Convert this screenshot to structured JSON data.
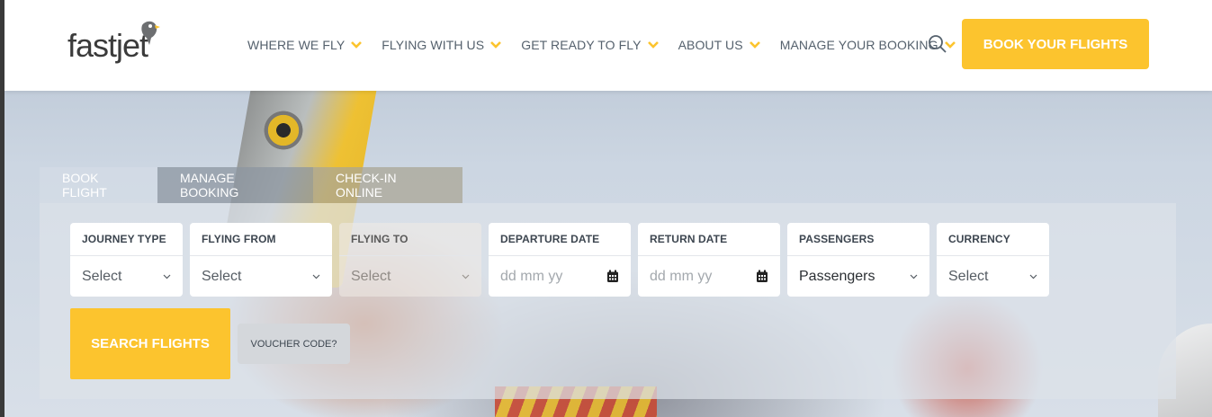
{
  "brand": {
    "logo_text": "fastjet",
    "accent": "#fcc42e",
    "text_color": "#55616d"
  },
  "nav": {
    "items": [
      {
        "label": "WHERE WE FLY"
      },
      {
        "label": "FLYING WITH US"
      },
      {
        "label": "GET READY TO FLY"
      },
      {
        "label": "ABOUT US"
      },
      {
        "label": "MANAGE YOUR BOOKING"
      }
    ],
    "search_icon": "search-icon",
    "cta_label": "BOOK YOUR FLIGHTS"
  },
  "widget": {
    "tabs": [
      {
        "label": "BOOK FLIGHT"
      },
      {
        "label": "MANAGE BOOKING"
      },
      {
        "label": "CHECK-IN ONLINE"
      }
    ],
    "fields": {
      "journey_type": {
        "label": "JOURNEY TYPE",
        "value": "Select"
      },
      "flying_from": {
        "label": "FLYING FROM",
        "value": "Select"
      },
      "flying_to": {
        "label": "FLYING TO",
        "value": "Select"
      },
      "departure_date": {
        "label": "DEPARTURE DATE",
        "placeholder": "dd mm yy"
      },
      "return_date": {
        "label": "RETURN DATE",
        "placeholder": "dd mm yy"
      },
      "passengers": {
        "label": "PASSENGERS",
        "value": "Passengers"
      },
      "currency": {
        "label": "CURRENCY",
        "value": "Select"
      }
    },
    "search_label": "SEARCH FLIGHTS",
    "voucher_label": "VOUCHER CODE?"
  }
}
